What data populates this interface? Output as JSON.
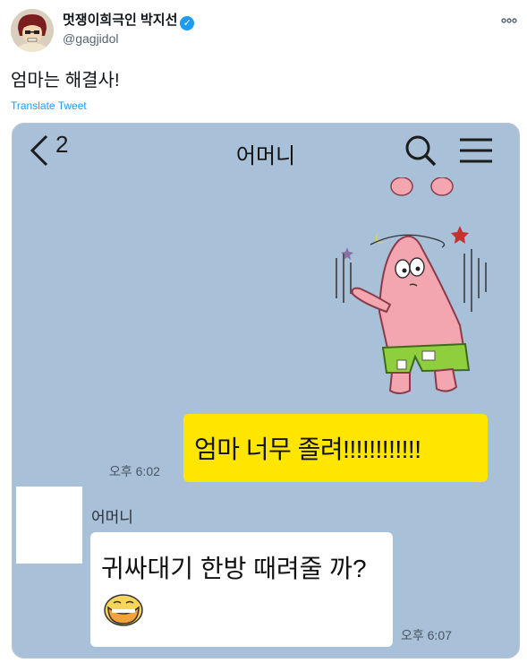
{
  "author": {
    "display_name": "멋쟁이희극인 박지선",
    "handle": "@gagjidol",
    "verified_icon": "verified-badge-icon"
  },
  "tweet": {
    "text": "엄마는 해결사!",
    "translate_label": "Translate Tweet"
  },
  "chat": {
    "back_count": "2",
    "title": "어머니",
    "messages": [
      {
        "sender": "me",
        "text": "엄마 너무 졸려!!!!!!!!!!!!",
        "time": "오후 6:02",
        "color": "#ffe600"
      },
      {
        "sender": "어머니",
        "text": "귀싸대기 한방 때려줄 까?",
        "time": "오후 6:07",
        "color": "#ffffff",
        "emoji": "grinning-duck-emoji"
      }
    ],
    "background_color": "#a8c0d8"
  },
  "colors": {
    "accent": "#1d9bf0"
  }
}
